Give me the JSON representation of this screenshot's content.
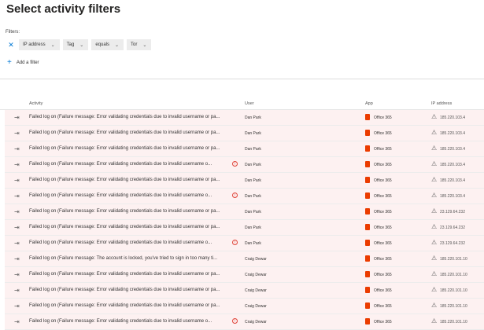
{
  "title": "Select activity filters",
  "filters": {
    "label": "Filters:",
    "clear_icon": "close-icon",
    "dropdowns": [
      "IP address",
      "Tag",
      "equals",
      "Tor"
    ],
    "add_label": "Add a filter"
  },
  "table": {
    "headers": {
      "activity": "Activity",
      "user": "User",
      "app": "App",
      "ip": "IP address"
    },
    "rows": [
      {
        "activity": "Failed log on (Failure message: Error validating credentials due to invalid username or pa...",
        "alert": false,
        "user": "Dan Park",
        "app": "Office 365",
        "ip": "185.220.103.4"
      },
      {
        "activity": "Failed log on (Failure message: Error validating credentials due to invalid username or pa...",
        "alert": false,
        "user": "Dan Park",
        "app": "Office 365",
        "ip": "185.220.103.4"
      },
      {
        "activity": "Failed log on (Failure message: Error validating credentials due to invalid username or pa...",
        "alert": false,
        "user": "Dan Park",
        "app": "Office 365",
        "ip": "185.220.103.4"
      },
      {
        "activity": "Failed log on (Failure message: Error validating credentials due to invalid username o...",
        "alert": true,
        "user": "Dan Park",
        "app": "Office 365",
        "ip": "185.220.103.4"
      },
      {
        "activity": "Failed log on (Failure message: Error validating credentials due to invalid username or pa...",
        "alert": false,
        "user": "Dan Park",
        "app": "Office 365",
        "ip": "185.220.103.4"
      },
      {
        "activity": "Failed log on (Failure message: Error validating credentials due to invalid username o...",
        "alert": true,
        "user": "Dan Park",
        "app": "Office 365",
        "ip": "185.220.103.4"
      },
      {
        "activity": "Failed log on (Failure message: Error validating credentials due to invalid username or pa...",
        "alert": false,
        "user": "Dan Park",
        "app": "Office 365",
        "ip": "23.129.64.232"
      },
      {
        "activity": "Failed log on (Failure message: Error validating credentials due to invalid username or pa...",
        "alert": false,
        "user": "Dan Park",
        "app": "Office 365",
        "ip": "23.129.64.232"
      },
      {
        "activity": "Failed log on (Failure message: Error validating credentials due to invalid username o...",
        "alert": true,
        "user": "Dan Park",
        "app": "Office 365",
        "ip": "23.129.64.232"
      },
      {
        "activity": "Failed log on (Failure message: The account is locked, you've tried to sign in too many ti...",
        "alert": false,
        "user": "Craig Dewar",
        "app": "Office 365",
        "ip": "185.220.101.10"
      },
      {
        "activity": "Failed log on (Failure message: Error validating credentials due to invalid username or pa...",
        "alert": false,
        "user": "Craig Dewar",
        "app": "Office 365",
        "ip": "185.220.101.10"
      },
      {
        "activity": "Failed log on (Failure message: Error validating credentials due to invalid username or pa...",
        "alert": false,
        "user": "Craig Dewar",
        "app": "Office 365",
        "ip": "185.220.101.10"
      },
      {
        "activity": "Failed log on (Failure message: Error validating credentials due to invalid username or pa...",
        "alert": false,
        "user": "Craig Dewar",
        "app": "Office 365",
        "ip": "185.220.101.10"
      },
      {
        "activity": "Failed log on (Failure message: Error validating credentials due to invalid username o...",
        "alert": true,
        "user": "Craig Dewar",
        "app": "Office 365",
        "ip": "185.220.101.10"
      }
    ]
  },
  "colors": {
    "accent": "#0078d4",
    "office": "#eb3c00",
    "alert": "#e0453a",
    "row_bg": "#fdf1f1"
  }
}
